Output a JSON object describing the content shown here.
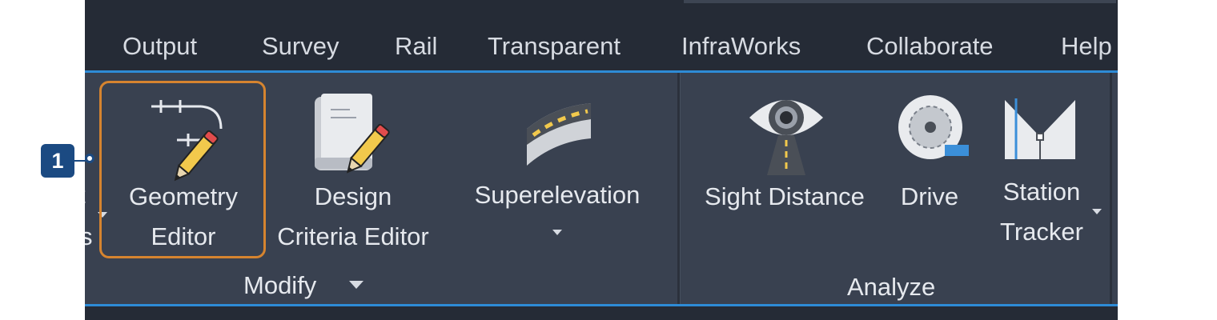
{
  "ribbon_tabs": [
    "Output",
    "Survey",
    "Rail",
    "Transparent",
    "InfraWorks",
    "Collaborate",
    "Help"
  ],
  "modify_panel": {
    "label": "Modify",
    "partial_left": {
      "line1": "t",
      "line2": "s"
    },
    "geometry_editor": {
      "line1": "Geometry",
      "line2": "Editor",
      "icon": "geometry-editor-icon"
    },
    "design_criteria_editor": {
      "line1": "Design",
      "line2": "Criteria Editor",
      "icon": "design-criteria-editor-icon"
    },
    "superelevation": {
      "label": "Superelevation",
      "icon": "superelevation-icon"
    }
  },
  "analyze_panel": {
    "label": "Analyze",
    "sight_distance": {
      "label": "Sight Distance",
      "icon": "sight-distance-icon"
    },
    "drive": {
      "label": "Drive",
      "icon": "drive-icon"
    },
    "station_tracker": {
      "line1": "Station",
      "line2": "Tracker",
      "icon": "station-tracker-icon"
    }
  },
  "callout": {
    "number": "1"
  },
  "colors": {
    "ribbon_bg": "#394150",
    "app_bg": "#252b36",
    "accent_blue": "#2e8bd6",
    "highlight_orange": "#d6842f",
    "callout_blue": "#1b4a82",
    "pencil_yellow": "#f2c94c",
    "pencil_red": "#e24c4c"
  }
}
